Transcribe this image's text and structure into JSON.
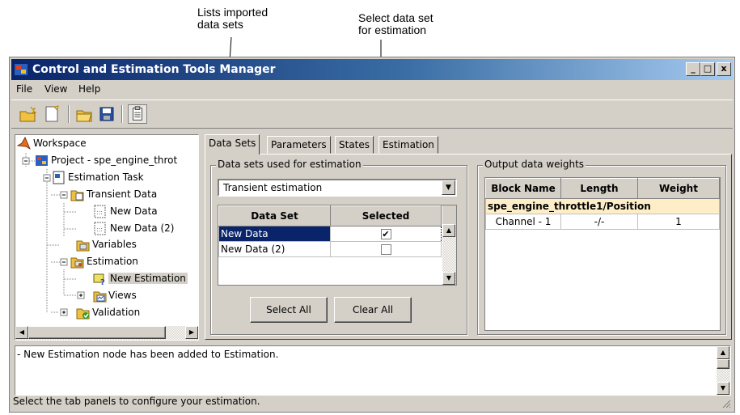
{
  "annotations": {
    "left": "Lists imported\ndata sets",
    "right": "Select data set\nfor estimation"
  },
  "window": {
    "title": "Control and Estimation Tools Manager",
    "controls": [
      "_",
      "□",
      "x"
    ]
  },
  "menu": [
    "File",
    "View",
    "Help"
  ],
  "toolbar": {
    "icons": [
      "open-project-icon",
      "new-task-icon",
      "open-file-icon",
      "save-icon",
      "clipboard-icon"
    ]
  },
  "tree": {
    "nodes": [
      {
        "label": "Workspace",
        "icon": "matlab-icon"
      },
      {
        "label": "Project - spe_engine_throt",
        "icon": "project-icon"
      },
      {
        "label": "Estimation Task",
        "icon": "task-icon"
      },
      {
        "label": "Transient Data",
        "icon": "data-folder-icon"
      },
      {
        "label": "New Data",
        "icon": "data-icon"
      },
      {
        "label": "New Data (2)",
        "icon": "data-icon"
      },
      {
        "label": "Variables",
        "icon": "variables-icon"
      },
      {
        "label": "Estimation",
        "icon": "estimation-folder-icon"
      },
      {
        "label": "New Estimation",
        "icon": "new-estimation-icon"
      },
      {
        "label": "Views",
        "icon": "views-icon"
      },
      {
        "label": "Validation",
        "icon": "validation-icon"
      }
    ],
    "selected": "New Estimation"
  },
  "tabs": [
    "Data Sets",
    "Parameters",
    "States",
    "Estimation"
  ],
  "active_tab": "Data Sets",
  "datasets_group": {
    "title": "Data sets used for estimation",
    "combo_value": "Transient estimation",
    "columns": [
      "Data Set",
      "Selected"
    ],
    "rows": [
      {
        "name": "New Data",
        "selected": true
      },
      {
        "name": "New Data (2)",
        "selected": false
      }
    ],
    "select_all": "Select All",
    "clear_all": "Clear All"
  },
  "weights_group": {
    "title": "Output data weights",
    "columns": [
      "Block Name",
      "Length",
      "Weight"
    ],
    "block": "spe_engine_throttle1/Position",
    "rows": [
      {
        "name": "Channel - 1",
        "length": "-/-",
        "weight": "1"
      }
    ]
  },
  "log": {
    "text": "- New Estimation node has been added to Estimation."
  },
  "status": "Select the tab panels to configure your estimation.",
  "colors": {
    "title_start": "#0a246a",
    "title_end": "#a6caf0",
    "selection": "#0a246a",
    "block_row": "#fdeec8",
    "face": "#d4d0c8"
  }
}
